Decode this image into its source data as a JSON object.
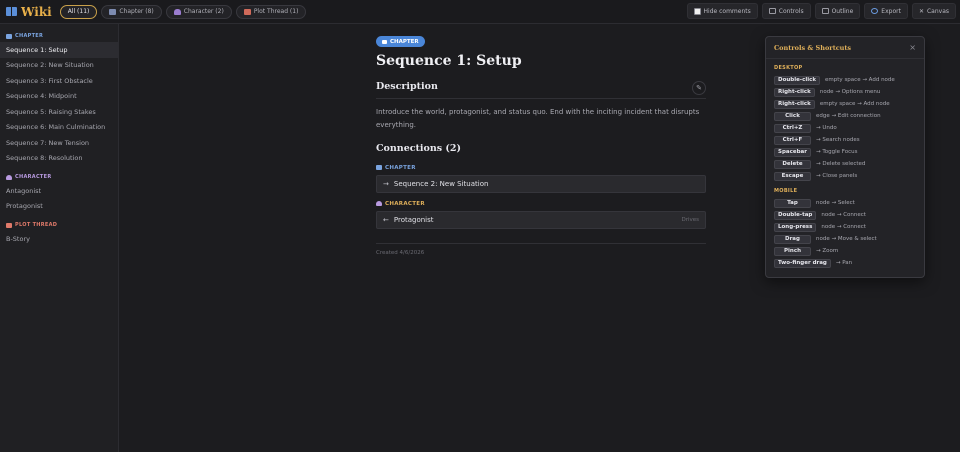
{
  "app": {
    "title": "Wiki"
  },
  "filters": [
    {
      "label": "All (11)",
      "icon": "none",
      "active": true
    },
    {
      "label": "Chapter (8)",
      "icon": "book-icon",
      "active": false
    },
    {
      "label": "Character (2)",
      "icon": "person-icon",
      "active": false
    },
    {
      "label": "Plot Thread (1)",
      "icon": "flag-icon",
      "active": false
    }
  ],
  "toolbar": {
    "hide_comments": "Hide comments",
    "controls": "Controls",
    "outline": "Outline",
    "export": "Export",
    "canvas": "Canvas"
  },
  "sidebar": {
    "chapter_head": "CHAPTER",
    "chapters": [
      "Sequence 1: Setup",
      "Sequence 2: New Situation",
      "Sequence 3: First Obstacle",
      "Sequence 4: Midpoint",
      "Sequence 5: Raising Stakes",
      "Sequence 6: Main Culmination",
      "Sequence 7: New Tension",
      "Sequence 8: Resolution"
    ],
    "character_head": "CHARACTER",
    "characters": [
      "Antagonist",
      "Protagonist"
    ],
    "plot_head": "PLOT THREAD",
    "plots": [
      "B-Story"
    ]
  },
  "main": {
    "badge": "CHAPTER",
    "title": "Sequence 1: Setup",
    "description_heading": "Description",
    "description": "Introduce the world, protagonist, and status quo. End with the inciting incident that disrupts everything.",
    "connections_heading": "Connections (2)",
    "chapter_label": "CHAPTER",
    "chapter_link_arrow": "→",
    "chapter_link": "Sequence 2: New Situation",
    "character_label": "CHARACTER",
    "character_link_arrow": "←",
    "character_link": "Protagonist",
    "character_link_tag": "Drives",
    "created": "Created 4/6/2026"
  },
  "panel": {
    "title": "Controls & Shortcuts",
    "close": "×",
    "desktop_head": "DESKTOP",
    "desktop": [
      {
        "key": "Double-click",
        "desc": "empty space → Add node"
      },
      {
        "key": "Right-click",
        "desc": "node → Options menu"
      },
      {
        "key": "Right-click",
        "desc": "empty space → Add node"
      },
      {
        "key": "Click",
        "desc": "edge → Edit connection"
      },
      {
        "key": "Ctrl+Z",
        "desc": "→ Undo"
      },
      {
        "key": "Ctrl+F",
        "desc": "→ Search nodes"
      },
      {
        "key": "Spacebar",
        "desc": "→ Toggle Focus"
      },
      {
        "key": "Delete",
        "desc": "→ Delete selected"
      },
      {
        "key": "Escape",
        "desc": "→ Close panels"
      }
    ],
    "mobile_head": "MOBILE",
    "mobile": [
      {
        "key": "Tap",
        "desc": "node → Select"
      },
      {
        "key": "Double-tap",
        "desc": "node → Connect"
      },
      {
        "key": "Long-press",
        "desc": "node → Connect"
      },
      {
        "key": "Drag",
        "desc": "node → Move & select"
      },
      {
        "key": "Pinch",
        "desc": "→ Zoom"
      },
      {
        "key": "Two-finger drag",
        "desc": "→ Pan"
      }
    ]
  }
}
